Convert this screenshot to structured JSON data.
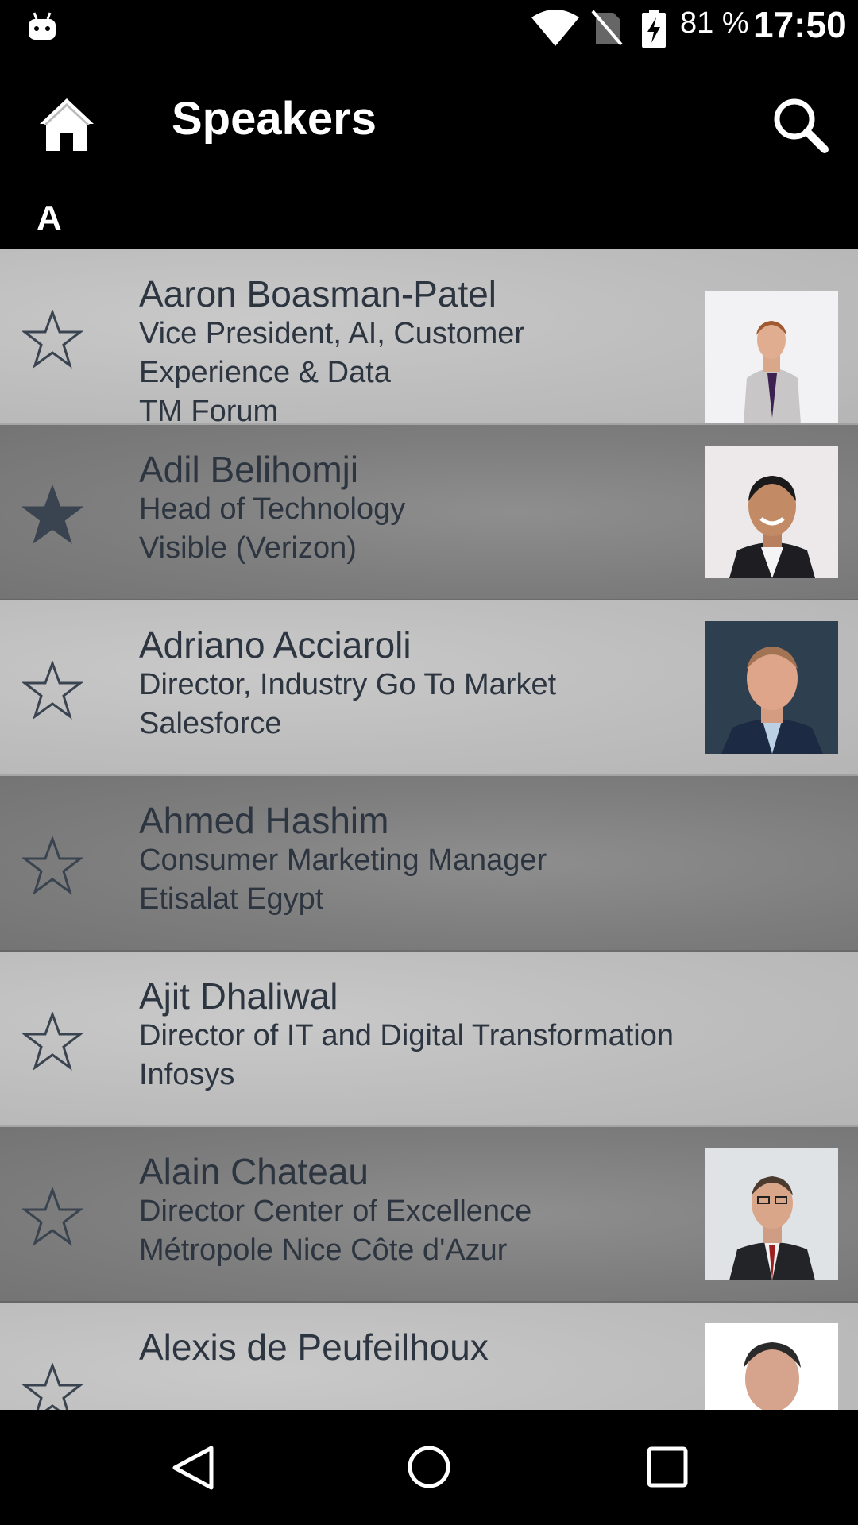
{
  "status_bar": {
    "battery_percent": "81 %",
    "time": "17:50",
    "icons": [
      "android-icon",
      "wifi-icon",
      "no-sim-icon",
      "battery-charging-icon"
    ]
  },
  "app_bar": {
    "title": "Speakers",
    "icons": [
      "home-icon",
      "search-icon"
    ]
  },
  "section": {
    "letter": "A"
  },
  "speakers": [
    {
      "name": "Aaron Boasman-Patel",
      "title_lines": [
        "Vice President, AI, Customer",
        "Experience & Data"
      ],
      "company": "TM Forum",
      "favorite": false,
      "has_photo": true
    },
    {
      "name": "Adil Belihomji",
      "title_lines": [
        "Head of Technology"
      ],
      "company": "Visible (Verizon)",
      "favorite": true,
      "has_photo": true
    },
    {
      "name": "Adriano Acciaroli",
      "title_lines": [
        "Director, Industry Go To Market"
      ],
      "company": "Salesforce",
      "favorite": false,
      "has_photo": true
    },
    {
      "name": "Ahmed Hashim",
      "title_lines": [
        "Consumer Marketing Manager"
      ],
      "company": "Etisalat Egypt",
      "favorite": false,
      "has_photo": false
    },
    {
      "name": "Ajit Dhaliwal",
      "title_lines": [
        "Director of IT and Digital Transformation"
      ],
      "company": "Infosys",
      "favorite": false,
      "has_photo": false
    },
    {
      "name": "Alain Chateau",
      "title_lines": [
        "Director Center of Excellence"
      ],
      "company": "Métropole Nice Côte d'Azur",
      "favorite": false,
      "has_photo": true
    },
    {
      "name": "Alexis de Peufeilhoux",
      "title_lines": [],
      "company": "",
      "favorite": false,
      "has_photo": true
    }
  ],
  "nav_bar": {
    "icons": [
      "back-icon",
      "home-circle-icon",
      "recents-icon"
    ]
  }
}
